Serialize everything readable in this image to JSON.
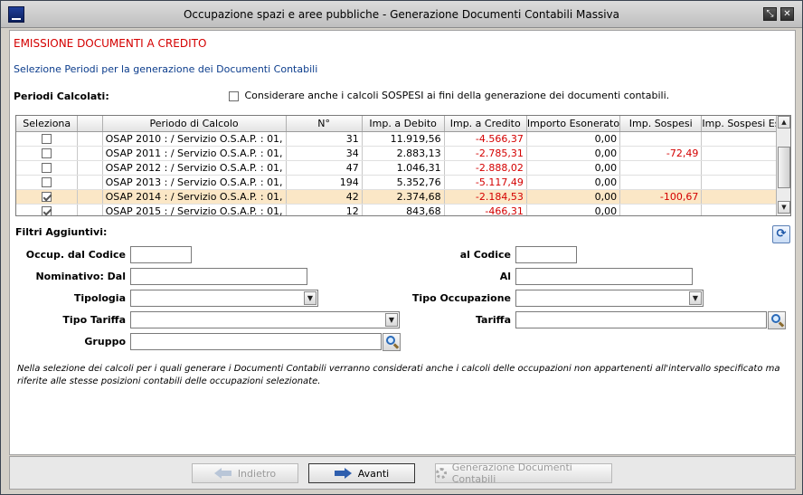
{
  "window": {
    "title": "Occupazione spazi e aree pubbliche - Generazione Documenti Contabili Massiva",
    "icon": "app-logo-icon",
    "buttons": {
      "restore": "⤡",
      "close": "✕"
    }
  },
  "header": {
    "title": "EMISSIONE DOCUMENTI A CREDITO",
    "subtitle": "Selezione Periodi per la generazione dei Documenti Contabili"
  },
  "periodi": {
    "label": "Periodi Calcolati:",
    "sospesi_checkbox_label": "Considerare anche i calcoli SOSPESI ai fini della generazione dei documenti contabili.",
    "sospesi_checked": false
  },
  "table": {
    "columns": [
      "Seleziona",
      "",
      "Periodo di Calcolo",
      "N°",
      "Imp. a Debito",
      "Imp. a Credito",
      "Importo Esonerato",
      "Imp. Sospesi",
      "Imp. Sospesi Es..."
    ],
    "rows": [
      {
        "checked": false,
        "periodo": "OSAP 2010 :  / Servizio O.S.A.P. : 01,",
        "n": "31",
        "debito": "11.919,56",
        "credito": "-4.566,37",
        "esonerato": "0,00",
        "sospesi": "",
        "sospesi_es": ""
      },
      {
        "checked": false,
        "periodo": "OSAP 2011 :  / Servizio O.S.A.P. : 01,",
        "n": "34",
        "debito": "2.883,13",
        "credito": "-2.785,31",
        "esonerato": "0,00",
        "sospesi": "-72,49",
        "sospesi_es": ""
      },
      {
        "checked": false,
        "periodo": "OSAP 2012 :  / Servizio O.S.A.P. : 01,",
        "n": "47",
        "debito": "1.046,31",
        "credito": "-2.888,02",
        "esonerato": "0,00",
        "sospesi": "",
        "sospesi_es": ""
      },
      {
        "checked": false,
        "periodo": "OSAP 2013 :  / Servizio O.S.A.P. : 01,",
        "n": "194",
        "debito": "5.352,76",
        "credito": "-5.117,49",
        "esonerato": "0,00",
        "sospesi": "",
        "sospesi_es": ""
      },
      {
        "checked": true,
        "periodo": "OSAP 2014 :  / Servizio O.S.A.P. : 01,",
        "n": "42",
        "debito": "2.374,68",
        "credito": "-2.184,53",
        "esonerato": "0,00",
        "sospesi": "-100,67",
        "sospesi_es": ""
      },
      {
        "checked": true,
        "periodo": "OSAP 2015 :  / Servizio O.S.A.P. : 01,",
        "n": "12",
        "debito": "843,68",
        "credito": "-466,31",
        "esonerato": "0,00",
        "sospesi": "",
        "sospesi_es": ""
      }
    ]
  },
  "filtri": {
    "title": "Filtri Aggiuntivi:",
    "occup_dal_codice": {
      "label": "Occup. dal Codice",
      "value": ""
    },
    "al_codice": {
      "label": "al Codice",
      "value": ""
    },
    "nominativo_dal": {
      "label": "Nominativo: Dal",
      "value": ""
    },
    "al": {
      "label": "Al",
      "value": ""
    },
    "tipologia": {
      "label": "Tipologia",
      "value": ""
    },
    "tipo_occupazione": {
      "label": "Tipo Occupazione",
      "value": ""
    },
    "tipo_tariffa": {
      "label": "Tipo Tariffa",
      "value": ""
    },
    "tariffa": {
      "label": "Tariffa",
      "value": ""
    },
    "gruppo": {
      "label": "Gruppo",
      "value": ""
    }
  },
  "note": "Nella selezione dei calcoli per i quali generare i Documenti Contabili verranno considerati anche i calcoli delle occupazioni non appartenenti all'intervallo specificato ma riferite alle stesse posizioni contabili delle occupazioni selezionate.",
  "footer": {
    "indietro": "Indietro",
    "avanti": "Avanti",
    "generazione": "Generazione Documenti Contabili"
  }
}
